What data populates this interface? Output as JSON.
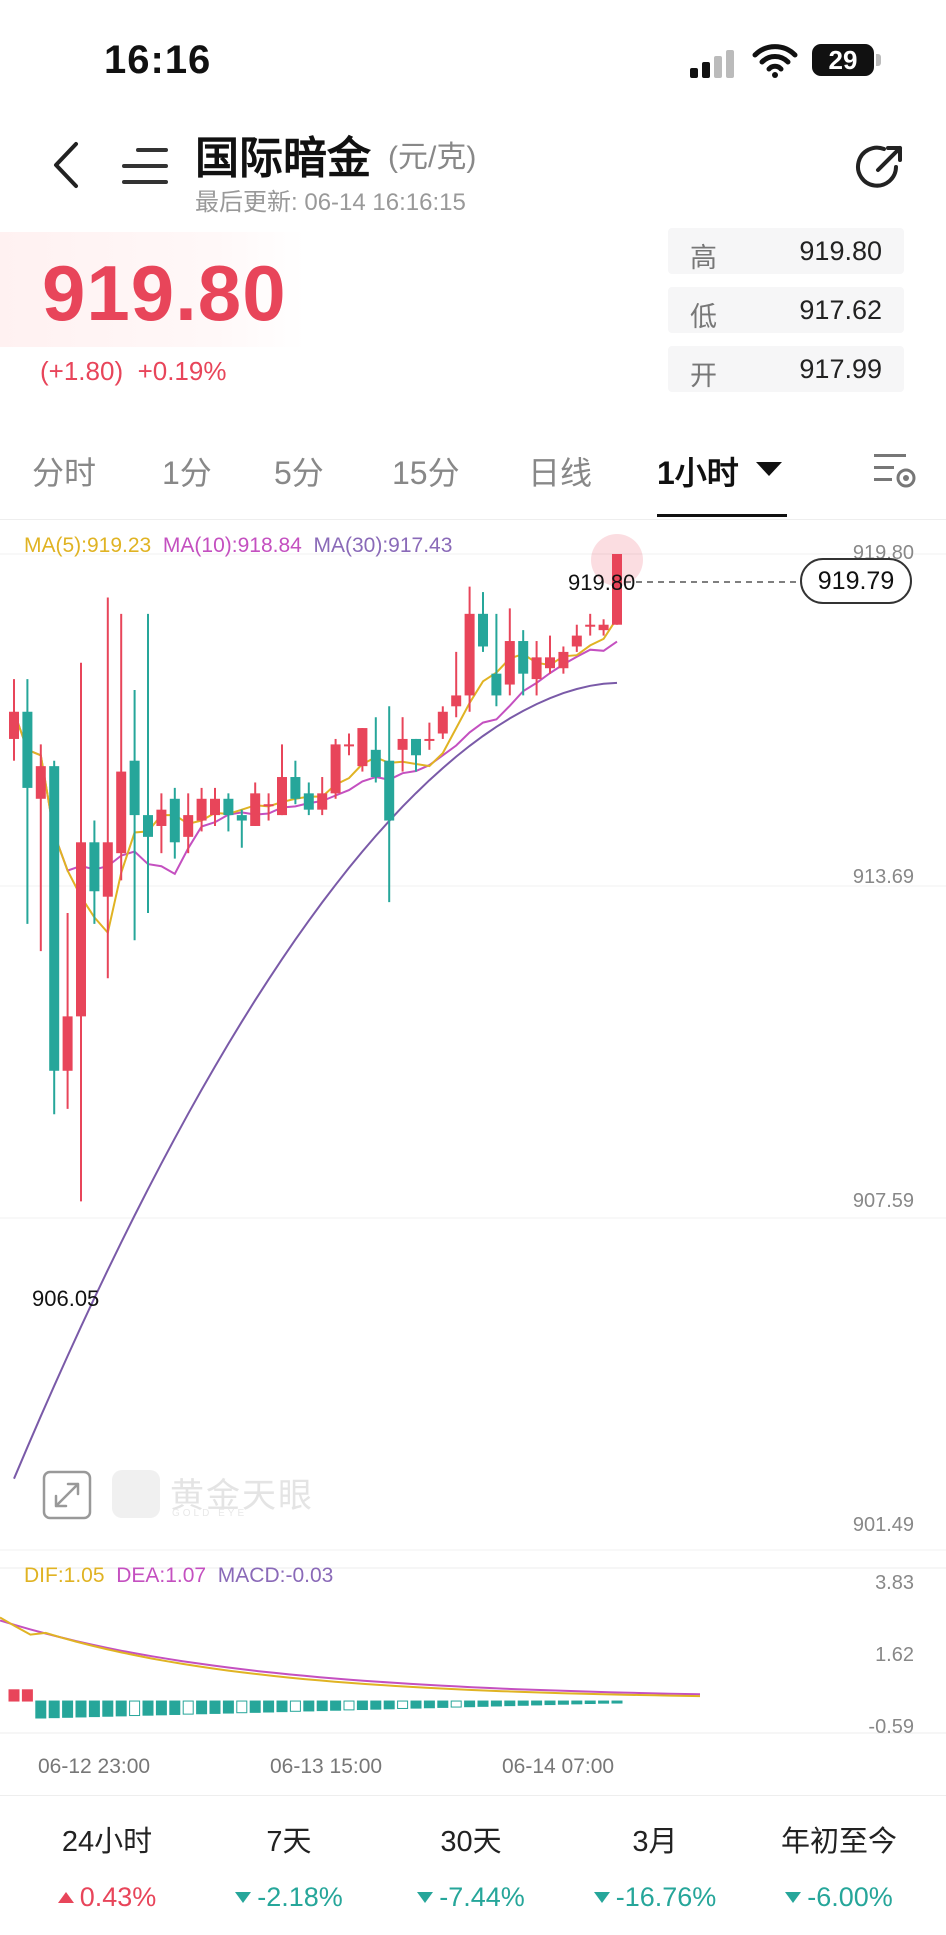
{
  "status_bar": {
    "time": "16:16",
    "battery": "29"
  },
  "header": {
    "title": "国际暗金",
    "unit": "(元/克)",
    "updated_label": "最后更新:",
    "updated_time": "06-14 16:16:15"
  },
  "quote": {
    "price": "919.80",
    "change_abs": "(+1.80)",
    "change_pct": "+0.19%",
    "high_label": "高",
    "high": "919.80",
    "low_label": "低",
    "low": "917.62",
    "open_label": "开",
    "open": "917.99"
  },
  "tabs": [
    {
      "label": "分时"
    },
    {
      "label": "1分"
    },
    {
      "label": "5分"
    },
    {
      "label": "15分"
    },
    {
      "label": "日线"
    },
    {
      "label": "1小时",
      "active": true
    }
  ],
  "chart": {
    "ma_legend": {
      "ma5": "MA(5):919.23",
      "ma10": "MA(10):918.84",
      "ma30": "MA(30):917.43"
    },
    "y_axis": [
      "919.80",
      "913.69",
      "907.59",
      "901.49"
    ],
    "high_marker": "919.80",
    "low_marker": "906.05",
    "last_price_tag": "919.79",
    "watermark": "黄金天眼",
    "watermark_sub": "GOLD EYE",
    "macd_legend": {
      "dif": "DIF:1.05",
      "dea": "DEA:1.07",
      "macd": "MACD:-0.03"
    },
    "macd_axis": [
      "3.83",
      "1.62",
      "-0.59"
    ],
    "time_labels": [
      "06-12 23:00",
      "06-13 15:00",
      "06-14 07:00"
    ],
    "colors": {
      "up": "#e8455a",
      "down": "#26a69a",
      "ma5": "#e0b323",
      "ma10": "#c450c0",
      "ma30": "#7a5aa8"
    }
  },
  "chart_data": {
    "type": "candlestick",
    "timeframe": "1小时",
    "ylim": [
      901.49,
      919.8
    ],
    "candles": [
      {
        "o": 916.4,
        "c": 916.9,
        "h": 917.5,
        "l": 916.0
      },
      {
        "o": 916.9,
        "c": 915.5,
        "h": 917.5,
        "l": 913.0
      },
      {
        "o": 915.3,
        "c": 915.9,
        "h": 916.3,
        "l": 912.5
      },
      {
        "o": 915.9,
        "c": 910.3,
        "h": 916.0,
        "l": 909.5
      },
      {
        "o": 910.3,
        "c": 911.3,
        "h": 913.2,
        "l": 909.6
      },
      {
        "o": 911.3,
        "c": 914.5,
        "h": 917.8,
        "l": 907.9
      },
      {
        "o": 914.5,
        "c": 913.6,
        "h": 914.9,
        "l": 913.0
      },
      {
        "o": 913.5,
        "c": 914.5,
        "h": 919.0,
        "l": 912.0
      },
      {
        "o": 914.3,
        "c": 915.8,
        "h": 918.7,
        "l": 913.8
      },
      {
        "o": 916.0,
        "c": 915.0,
        "h": 917.3,
        "l": 912.7
      },
      {
        "o": 915.0,
        "c": 914.6,
        "h": 918.7,
        "l": 913.2
      },
      {
        "o": 914.8,
        "c": 915.1,
        "h": 915.4,
        "l": 914.3
      },
      {
        "o": 915.3,
        "c": 914.5,
        "h": 915.5,
        "l": 914.2
      },
      {
        "o": 914.6,
        "c": 915.0,
        "h": 915.4,
        "l": 914.3
      },
      {
        "o": 914.9,
        "c": 915.3,
        "h": 915.5,
        "l": 914.7
      },
      {
        "o": 915.0,
        "c": 915.3,
        "h": 915.5,
        "l": 914.8
      },
      {
        "o": 915.3,
        "c": 915.0,
        "h": 915.4,
        "l": 914.7
      },
      {
        "o": 915.0,
        "c": 914.9,
        "h": 915.1,
        "l": 914.4
      },
      {
        "o": 914.8,
        "c": 915.4,
        "h": 915.6,
        "l": 914.8
      },
      {
        "o": 915.2,
        "c": 915.2,
        "h": 915.4,
        "l": 914.9
      },
      {
        "o": 915.0,
        "c": 915.7,
        "h": 916.3,
        "l": 915.0
      },
      {
        "o": 915.7,
        "c": 915.3,
        "h": 916.0,
        "l": 915.2
      },
      {
        "o": 915.4,
        "c": 915.1,
        "h": 915.6,
        "l": 915.0
      },
      {
        "o": 915.1,
        "c": 915.4,
        "h": 915.7,
        "l": 915.0
      },
      {
        "o": 915.4,
        "c": 916.3,
        "h": 916.4,
        "l": 915.3
      },
      {
        "o": 916.3,
        "c": 916.3,
        "h": 916.5,
        "l": 916.1
      },
      {
        "o": 915.9,
        "c": 916.6,
        "h": 916.6,
        "l": 915.8
      },
      {
        "o": 916.2,
        "c": 915.7,
        "h": 916.8,
        "l": 915.6
      },
      {
        "o": 916.0,
        "c": 914.9,
        "h": 917.0,
        "l": 913.4
      },
      {
        "o": 916.2,
        "c": 916.4,
        "h": 916.8,
        "l": 915.8
      },
      {
        "o": 916.4,
        "c": 916.1,
        "h": 916.4,
        "l": 915.8
      },
      {
        "o": 916.4,
        "c": 916.4,
        "h": 916.7,
        "l": 916.2
      },
      {
        "o": 916.5,
        "c": 916.9,
        "h": 917.0,
        "l": 916.4
      },
      {
        "o": 917.0,
        "c": 917.2,
        "h": 918.0,
        "l": 916.8
      },
      {
        "o": 917.2,
        "c": 918.7,
        "h": 919.2,
        "l": 916.9
      },
      {
        "o": 918.7,
        "c": 918.1,
        "h": 919.1,
        "l": 918.0
      },
      {
        "o": 917.6,
        "c": 917.2,
        "h": 918.7,
        "l": 917.0
      },
      {
        "o": 917.4,
        "c": 918.2,
        "h": 918.8,
        "l": 917.2
      },
      {
        "o": 918.2,
        "c": 917.6,
        "h": 918.4,
        "l": 917.2
      },
      {
        "o": 917.5,
        "c": 917.9,
        "h": 918.2,
        "l": 917.2
      },
      {
        "o": 917.7,
        "c": 917.9,
        "h": 918.3,
        "l": 917.6
      },
      {
        "o": 917.7,
        "c": 918.0,
        "h": 918.1,
        "l": 917.6
      },
      {
        "o": 918.1,
        "c": 918.3,
        "h": 918.5,
        "l": 918.0
      },
      {
        "o": 918.5,
        "c": 918.5,
        "h": 918.7,
        "l": 918.3
      },
      {
        "o": 918.4,
        "c": 918.5,
        "h": 918.6,
        "l": 918.3
      },
      {
        "o": 918.5,
        "c": 919.8,
        "h": 919.8,
        "l": 918.5
      }
    ],
    "ma30_start": 902.8,
    "ma30_end": 917.43
  },
  "periods": [
    {
      "label": "24小时",
      "value": "0.43%",
      "dir": "up"
    },
    {
      "label": "7天",
      "value": "-2.18%",
      "dir": "down"
    },
    {
      "label": "30天",
      "value": "-7.44%",
      "dir": "down"
    },
    {
      "label": "3月",
      "value": "-16.76%",
      "dir": "down"
    },
    {
      "label": "年初至今",
      "value": "-6.00%",
      "dir": "down"
    }
  ]
}
